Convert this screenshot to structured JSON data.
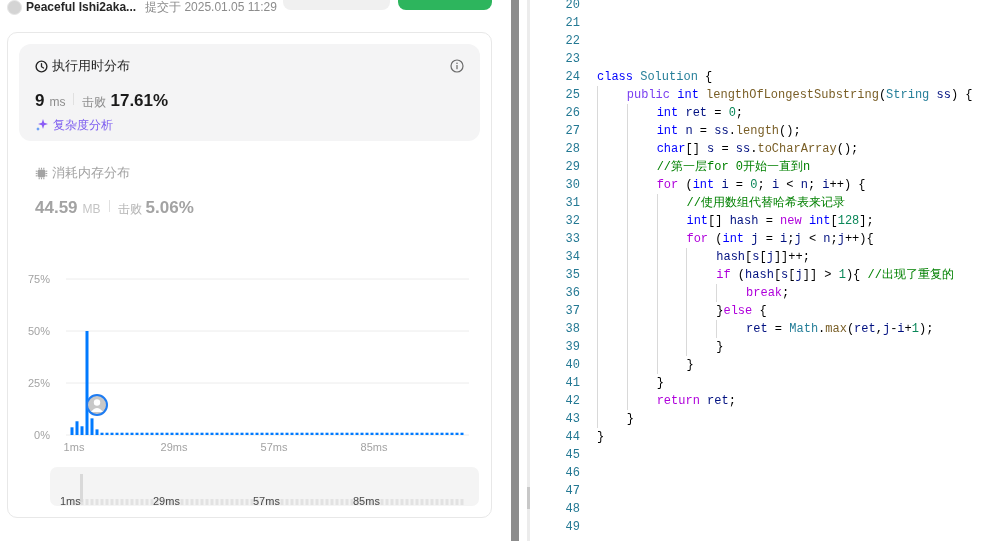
{
  "submission": {
    "author": "Peaceful Ishi2aka...",
    "submitted": "提交于 2025.01.05 11:29"
  },
  "header_buttons": [
    {
      "kind": "secondary"
    },
    {
      "kind": "primary"
    }
  ],
  "sections": [
    {
      "kind": "time",
      "title": "执行用时分布",
      "value": "9",
      "unit": "ms",
      "beat_label": "击败",
      "beat": "17.61%",
      "selected": true,
      "analysis_link": "复杂度分析"
    },
    {
      "kind": "memory",
      "title": "消耗内存分布",
      "value": "44.59",
      "unit": "MB",
      "beat_label": "击败",
      "beat": "5.06%",
      "selected": false
    }
  ],
  "chart": {
    "chart_data": {
      "type": "bar",
      "categories": [
        "1ms",
        null,
        null,
        null,
        null,
        null,
        null,
        null,
        null,
        null,
        null,
        null,
        null,
        null,
        null,
        null,
        null,
        null,
        null,
        null,
        "29ms",
        null,
        null,
        null,
        null,
        null,
        null,
        null,
        null,
        null,
        null,
        null,
        null,
        null,
        null,
        null,
        null,
        null,
        null,
        null,
        "57ms",
        null,
        null,
        null,
        null,
        null,
        null,
        null,
        null,
        null,
        null,
        null,
        null,
        null,
        null,
        null,
        null,
        null,
        null,
        null,
        "85ms",
        null,
        null,
        null,
        null,
        null,
        null,
        null,
        null,
        null,
        null,
        null,
        null,
        null,
        null,
        null,
        null,
        null,
        null
      ],
      "series": [
        {
          "color": "#007aff",
          "values": [
            3.7,
            6.6,
            4.2,
            50,
            8,
            2.7,
            1.1,
            1.1,
            1.1,
            1.1,
            1.1,
            1.1,
            1.1,
            1.1,
            1.1,
            1.1,
            1.1,
            1.1,
            1.1,
            1.1,
            1.1,
            1.1,
            1.1,
            1.1,
            1.1,
            1.1,
            1.1,
            1.1,
            1.1,
            1.1,
            1.1,
            1.1,
            1.1,
            1.1,
            1.1,
            1.1,
            1.1,
            1.1,
            1.1,
            1.1,
            1.1,
            1.1,
            1.1,
            1.1,
            1.1,
            1.1,
            1.1,
            1.1,
            1.1,
            1.1,
            1.1,
            1.1,
            1.1,
            1.1,
            1.1,
            1.1,
            1.1,
            1.1,
            1.1,
            1.1,
            1.1,
            1.1,
            1.1,
            1.1,
            1.1,
            1.1,
            1.1,
            1.1,
            1.1,
            1.1,
            1.1,
            1.1,
            1.1,
            1.1,
            1.1,
            1.1,
            1.1,
            1.1,
            1.1
          ]
        }
      ],
      "ylim": [
        0,
        75
      ],
      "yticks": [
        {
          "value": 0,
          "label": "0%"
        },
        {
          "value": 25,
          "label": "25%"
        },
        {
          "value": 50,
          "label": "50%"
        },
        {
          "value": 75,
          "label": "75%"
        }
      ]
    }
  },
  "range_slider": {
    "level": 0.07,
    "labels": [
      "1ms",
      "29ms",
      "57ms",
      "85ms"
    ]
  },
  "editor": {
    "lines": [
      {
        "number": "20"
      },
      {
        "number": "21"
      },
      {
        "number": "22"
      },
      {
        "number": "23"
      },
      {
        "number": "24",
        "tokens": [
          {
            "kind": "kw",
            "text": "class"
          },
          {
            "kind": "type",
            "text": " Solution"
          },
          {
            "kind": "pl",
            "text": " {"
          }
        ]
      },
      {
        "number": "25",
        "tokens": [
          {
            "kind": "mod",
            "text": "    public"
          },
          {
            "kind": "kw",
            "text": " int"
          },
          {
            "kind": "fn",
            "text": " lengthOfLongestSubstring"
          },
          {
            "kind": "pl",
            "text": "("
          },
          {
            "kind": "type",
            "text": "String"
          },
          {
            "kind": "var",
            "text": " ss"
          },
          {
            "kind": "pl",
            "text": ") {"
          }
        ]
      },
      {
        "number": "26",
        "tokens": [
          {
            "kind": "kw",
            "text": "        int"
          },
          {
            "kind": "var",
            "text": " ret"
          },
          {
            "kind": "pl",
            "text": " = "
          },
          {
            "kind": "num",
            "text": "0"
          },
          {
            "kind": "pl",
            "text": ";"
          }
        ]
      },
      {
        "number": "27",
        "tokens": [
          {
            "kind": "kw",
            "text": "        int"
          },
          {
            "kind": "var",
            "text": " n"
          },
          {
            "kind": "pl",
            "text": " = "
          },
          {
            "kind": "var",
            "text": "ss"
          },
          {
            "kind": "pl",
            "text": "."
          },
          {
            "kind": "fn",
            "text": "length"
          },
          {
            "kind": "pl",
            "text": "();"
          }
        ]
      },
      {
        "number": "28",
        "tokens": [
          {
            "kind": "kw",
            "text": "        char"
          },
          {
            "kind": "pl",
            "text": "[] "
          },
          {
            "kind": "var",
            "text": "s"
          },
          {
            "kind": "pl",
            "text": " = "
          },
          {
            "kind": "var",
            "text": "ss"
          },
          {
            "kind": "pl",
            "text": "."
          },
          {
            "kind": "fn",
            "text": "toCharArray"
          },
          {
            "kind": "pl",
            "text": "();"
          }
        ]
      },
      {
        "number": "29",
        "tokens": [
          {
            "kind": "cm",
            "text": "        //第一层for 0开始一直到n"
          }
        ]
      },
      {
        "number": "30",
        "tokens": [
          {
            "kind": "ctl",
            "text": "        for"
          },
          {
            "kind": "pl",
            "text": " ("
          },
          {
            "kind": "kw",
            "text": "int"
          },
          {
            "kind": "var",
            "text": " i"
          },
          {
            "kind": "pl",
            "text": " = "
          },
          {
            "kind": "num",
            "text": "0"
          },
          {
            "kind": "pl",
            "text": "; "
          },
          {
            "kind": "var",
            "text": "i"
          },
          {
            "kind": "pl",
            "text": " < "
          },
          {
            "kind": "var",
            "text": "n"
          },
          {
            "kind": "pl",
            "text": "; "
          },
          {
            "kind": "var",
            "text": "i"
          },
          {
            "kind": "pl",
            "text": "++) {"
          }
        ]
      },
      {
        "number": "31",
        "tokens": [
          {
            "kind": "cm",
            "text": "            //使用数组代替哈希表来记录"
          }
        ]
      },
      {
        "number": "32",
        "tokens": [
          {
            "kind": "kw",
            "text": "            int"
          },
          {
            "kind": "pl",
            "text": "[] "
          },
          {
            "kind": "var",
            "text": "hash"
          },
          {
            "kind": "pl",
            "text": " = "
          },
          {
            "kind": "ctl",
            "text": "new"
          },
          {
            "kind": "kw",
            "text": " int"
          },
          {
            "kind": "pl",
            "text": "["
          },
          {
            "kind": "num",
            "text": "128"
          },
          {
            "kind": "pl",
            "text": "];"
          }
        ]
      },
      {
        "number": "33",
        "tokens": [
          {
            "kind": "ctl",
            "text": "            for"
          },
          {
            "kind": "pl",
            "text": " ("
          },
          {
            "kind": "kw",
            "text": "int"
          },
          {
            "kind": "var",
            "text": " j"
          },
          {
            "kind": "pl",
            "text": " = "
          },
          {
            "kind": "var",
            "text": "i"
          },
          {
            "kind": "pl",
            "text": ";"
          },
          {
            "kind": "var",
            "text": "j"
          },
          {
            "kind": "pl",
            "text": " < "
          },
          {
            "kind": "var",
            "text": "n"
          },
          {
            "kind": "pl",
            "text": ";"
          },
          {
            "kind": "var",
            "text": "j"
          },
          {
            "kind": "pl",
            "text": "++){"
          }
        ]
      },
      {
        "number": "34",
        "tokens": [
          {
            "kind": "var",
            "text": "                hash"
          },
          {
            "kind": "pl",
            "text": "["
          },
          {
            "kind": "var",
            "text": "s"
          },
          {
            "kind": "pl",
            "text": "["
          },
          {
            "kind": "var",
            "text": "j"
          },
          {
            "kind": "pl",
            "text": "]]++;"
          }
        ]
      },
      {
        "number": "35",
        "tokens": [
          {
            "kind": "ctl",
            "text": "                if"
          },
          {
            "kind": "pl",
            "text": " ("
          },
          {
            "kind": "var",
            "text": "hash"
          },
          {
            "kind": "pl",
            "text": "["
          },
          {
            "kind": "var",
            "text": "s"
          },
          {
            "kind": "pl",
            "text": "["
          },
          {
            "kind": "var",
            "text": "j"
          },
          {
            "kind": "pl",
            "text": "]] > "
          },
          {
            "kind": "num",
            "text": "1"
          },
          {
            "kind": "pl",
            "text": "){"
          },
          {
            "kind": "cm",
            "text": " //出现了重复的"
          }
        ]
      },
      {
        "number": "36",
        "tokens": [
          {
            "kind": "ctl",
            "text": "                    break"
          },
          {
            "kind": "pl",
            "text": ";"
          }
        ]
      },
      {
        "number": "37",
        "tokens": [
          {
            "kind": "pl",
            "text": "                }"
          },
          {
            "kind": "ctl",
            "text": "else"
          },
          {
            "kind": "pl",
            "text": " {"
          }
        ]
      },
      {
        "number": "38",
        "tokens": [
          {
            "kind": "var",
            "text": "                    ret"
          },
          {
            "kind": "pl",
            "text": " = "
          },
          {
            "kind": "type",
            "text": "Math"
          },
          {
            "kind": "pl",
            "text": "."
          },
          {
            "kind": "fn",
            "text": "max"
          },
          {
            "kind": "pl",
            "text": "("
          },
          {
            "kind": "var",
            "text": "ret"
          },
          {
            "kind": "pl",
            "text": ","
          },
          {
            "kind": "var",
            "text": "j"
          },
          {
            "kind": "pl",
            "text": "-"
          },
          {
            "kind": "var",
            "text": "i"
          },
          {
            "kind": "pl",
            "text": "+"
          },
          {
            "kind": "num",
            "text": "1"
          },
          {
            "kind": "pl",
            "text": ");"
          }
        ]
      },
      {
        "number": "39",
        "tokens": [
          {
            "kind": "pl",
            "text": "                }"
          }
        ]
      },
      {
        "number": "40",
        "tokens": [
          {
            "kind": "pl",
            "text": "            }"
          }
        ]
      },
      {
        "number": "41",
        "tokens": [
          {
            "kind": "pl",
            "text": "        }"
          }
        ]
      },
      {
        "number": "42",
        "tokens": [
          {
            "kind": "ctl",
            "text": "        return"
          },
          {
            "kind": "var",
            "text": " ret"
          },
          {
            "kind": "pl",
            "text": ";"
          }
        ]
      },
      {
        "number": "43",
        "tokens": [
          {
            "kind": "pl",
            "text": "    }"
          }
        ]
      },
      {
        "number": "44",
        "tokens": [
          {
            "kind": "pl",
            "text": "}"
          }
        ]
      },
      {
        "number": "45"
      },
      {
        "number": "46"
      },
      {
        "number": "47"
      },
      {
        "number": "48"
      },
      {
        "number": "49"
      }
    ]
  }
}
